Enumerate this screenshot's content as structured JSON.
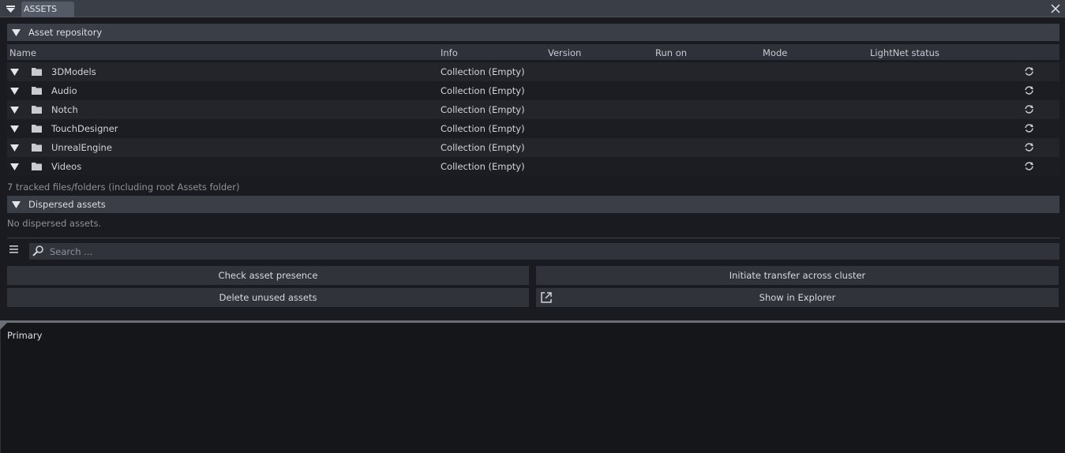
{
  "panel": {
    "tab_label": "ASSETS"
  },
  "repository": {
    "header": "Asset repository",
    "columns": [
      "Name",
      "Info",
      "Version",
      "Run on",
      "Mode",
      "LightNet status"
    ],
    "rows": [
      {
        "name": "3DModels",
        "info": "Collection (Empty)"
      },
      {
        "name": "Audio",
        "info": "Collection (Empty)"
      },
      {
        "name": "Notch",
        "info": "Collection (Empty)"
      },
      {
        "name": "TouchDesigner",
        "info": "Collection (Empty)"
      },
      {
        "name": "UnrealEngine",
        "info": "Collection (Empty)"
      },
      {
        "name": "Videos",
        "info": "Collection (Empty)"
      }
    ],
    "tracked_text": "7 tracked files/folders (including root Assets folder)"
  },
  "dispersed": {
    "header": "Dispersed assets",
    "empty_text": "No dispersed assets."
  },
  "search": {
    "placeholder": "Search ..."
  },
  "buttons": {
    "check_presence": "Check asset presence",
    "initiate_transfer": "Initiate transfer across cluster",
    "delete_unused": "Delete unused assets",
    "show_explorer": "Show in Explorer"
  },
  "lower_panel": {
    "label": "Primary"
  },
  "colors": {
    "background": "#1a1b20",
    "header": "#3a3e47",
    "tab": "#555b66",
    "button": "#30333a"
  },
  "icons": {
    "panel_menu": "triangle-down-icon",
    "close": "close-icon",
    "collapse": "triangle-down-icon",
    "folder": "folder-icon",
    "refresh": "refresh-icon",
    "menu": "hamburger-icon",
    "search": "magnifier-icon",
    "external": "external-link-icon"
  }
}
